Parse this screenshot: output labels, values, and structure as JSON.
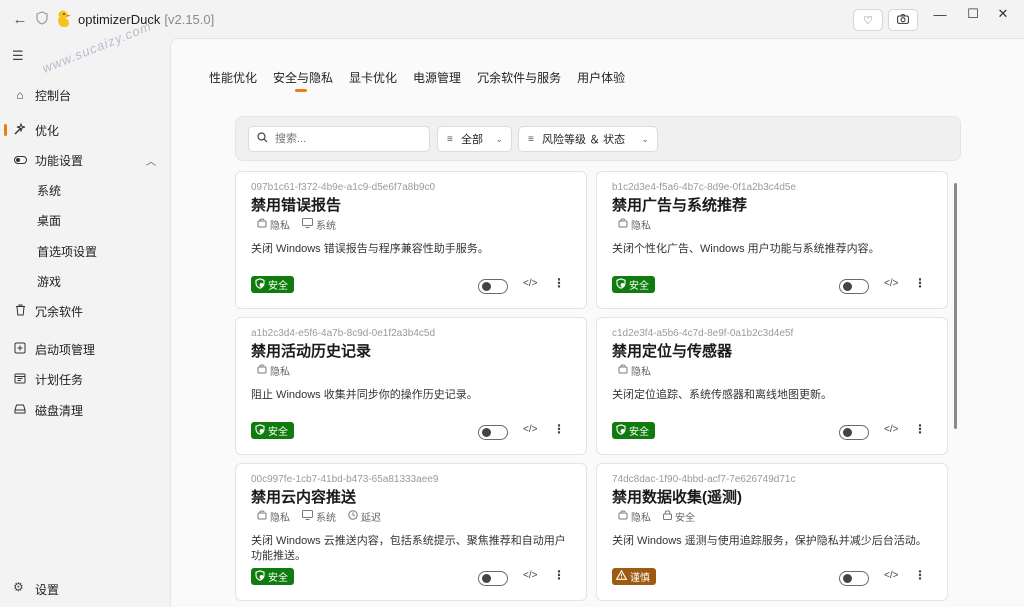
{
  "app": {
    "title": "optimizerDuck",
    "version": "[v2.15.0]",
    "watermark": "www.sucaizy.com"
  },
  "sidebar": {
    "items": [
      {
        "label": "控制台",
        "icon": "home-icon"
      },
      {
        "label": "优化",
        "icon": "optimize-icon",
        "active": true
      },
      {
        "label": "功能设置",
        "icon": "toggle-icon"
      },
      {
        "label": "系统",
        "sub": true
      },
      {
        "label": "桌面",
        "sub": true
      },
      {
        "label": "首选项设置",
        "sub": true
      },
      {
        "label": "游戏",
        "sub": true
      },
      {
        "label": "冗余软件",
        "icon": "trash-icon"
      },
      {
        "label": "启动项管理",
        "icon": "startup-icon"
      },
      {
        "label": "计划任务",
        "icon": "calendar-icon"
      },
      {
        "label": "磁盘清理",
        "icon": "disk-icon"
      }
    ],
    "settings_label": "设置"
  },
  "tabs": [
    {
      "label": "性能优化"
    },
    {
      "label": "安全与隐私",
      "active": true
    },
    {
      "label": "显卡优化"
    },
    {
      "label": "电源管理"
    },
    {
      "label": "冗余软件与服务"
    },
    {
      "label": "用户体验"
    }
  ],
  "filters": {
    "search_placeholder": "搜索...",
    "category_label": "全部",
    "risk_label": "风险等级 ＆ 状态"
  },
  "cards": [
    {
      "id": "097b1c61-f372-4b9e-a1c9-d5e6f7a8b9c0",
      "title": "禁用错误报告",
      "tags": [
        "隐私",
        "系统"
      ],
      "description": "关闭 Windows 错误报告与程序兼容性助手服务。",
      "badge": "安全",
      "badge_type": "safe",
      "enabled": false
    },
    {
      "id": "b1c2d3e4-f5a6-4b7c-8d9e-0f1a2b3c4d5e",
      "title": "禁用广告与系统推荐",
      "tags": [
        "隐私"
      ],
      "description": "关闭个性化广告、Windows 用户功能与系统推荐内容。",
      "badge": "安全",
      "badge_type": "safe",
      "enabled": false
    },
    {
      "id": "a1b2c3d4-e5f6-4a7b-8c9d-0e1f2a3b4c5d",
      "title": "禁用活动历史记录",
      "tags": [
        "隐私"
      ],
      "description": "阻止 Windows 收集并同步你的操作历史记录。",
      "badge": "安全",
      "badge_type": "safe",
      "enabled": false
    },
    {
      "id": "c1d2e3f4-a5b6-4c7d-8e9f-0a1b2c3d4e5f",
      "title": "禁用定位与传感器",
      "tags": [
        "隐私"
      ],
      "description": "关闭定位追踪、系统传感器和离线地图更新。",
      "badge": "安全",
      "badge_type": "safe",
      "enabled": false
    },
    {
      "id": "00c997fe-1cb7-41bd-b473-65a81333aee9",
      "title": "禁用云内容推送",
      "tags": [
        "隐私",
        "系统",
        "延迟"
      ],
      "description": "关闭 Windows 云推送内容，包括系统提示、聚焦推荐和自动用户功能推送。",
      "badge": "安全",
      "badge_type": "safe",
      "enabled": false
    },
    {
      "id": "74dc8dac-1f90-4bbd-acf7-7e626749d71c",
      "title": "禁用数据收集(遥测)",
      "tags": [
        "隐私",
        "安全"
      ],
      "description": "关闭 Windows 遥测与使用追踪服务，保护隐私并减少后台活动。",
      "badge": "谨慎",
      "badge_type": "caution",
      "enabled": false
    }
  ]
}
